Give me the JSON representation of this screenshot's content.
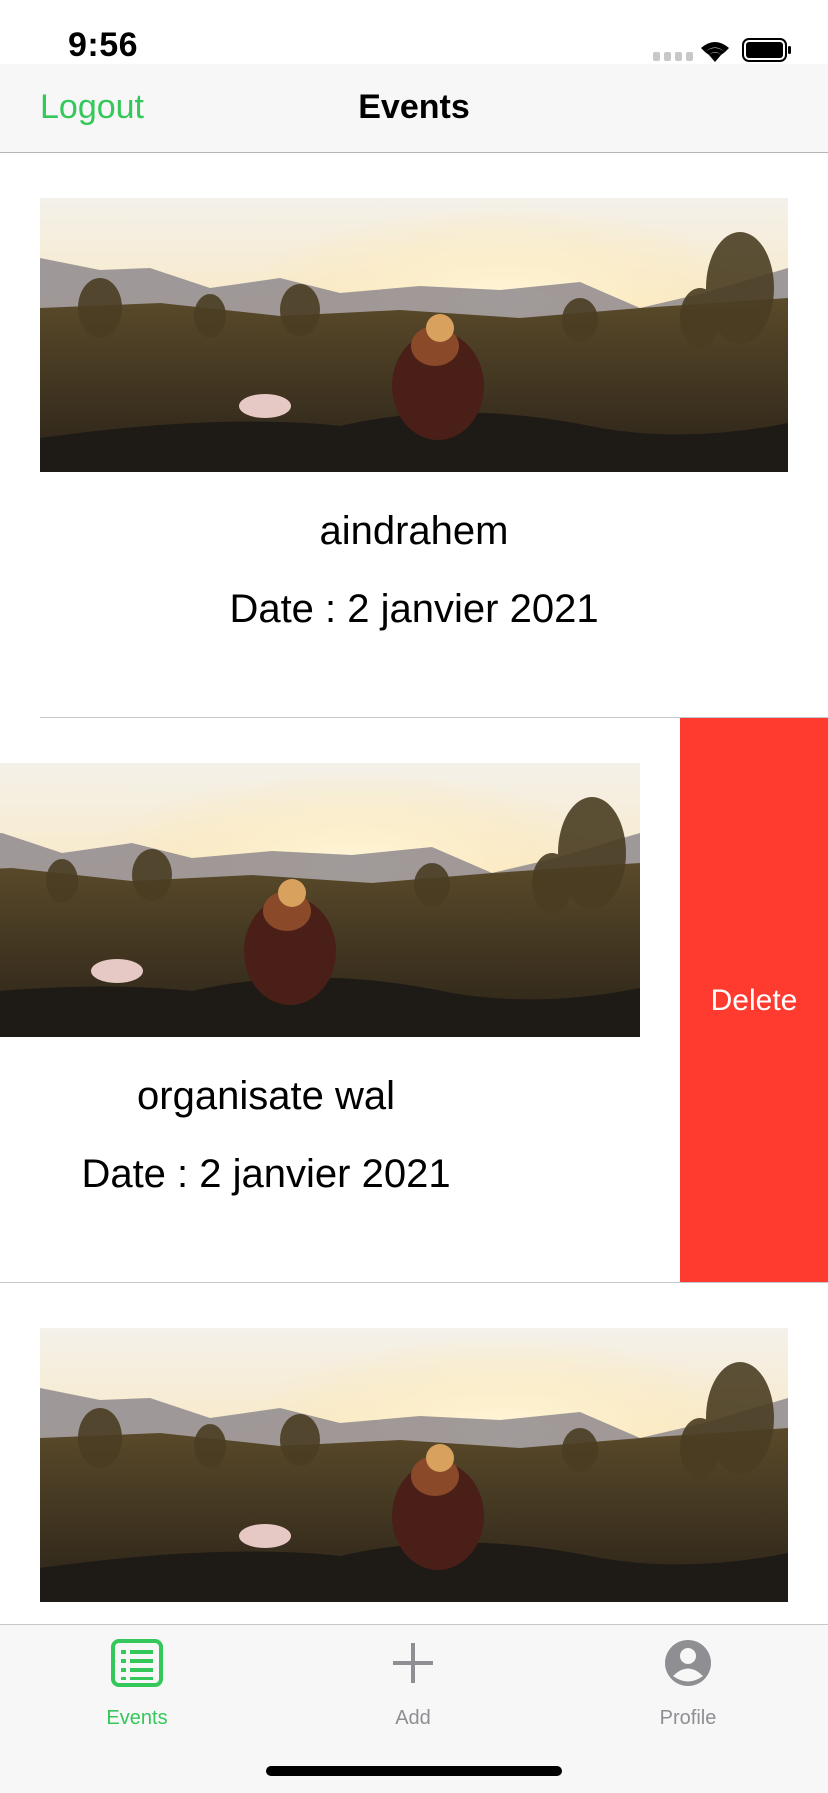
{
  "status_bar": {
    "time": "9:56"
  },
  "nav": {
    "logout_label": "Logout",
    "title": "Events"
  },
  "events": [
    {
      "name": "aindrahem",
      "date": "Date : 2 janvier 2021"
    },
    {
      "name": "organisate wal",
      "date": "Date : 2 janvier 2021",
      "delete_label": "Delete"
    },
    {
      "name": "",
      "date": ""
    }
  ],
  "tabs": [
    {
      "label": "Events",
      "icon": "list-icon",
      "selected": true
    },
    {
      "label": "Add",
      "icon": "plus-icon",
      "selected": false
    },
    {
      "label": "Profile",
      "icon": "person-circle-icon",
      "selected": false
    }
  ],
  "colors": {
    "accent": "#34c759",
    "delete": "#ff3b30",
    "inactive": "#8e8e93"
  }
}
